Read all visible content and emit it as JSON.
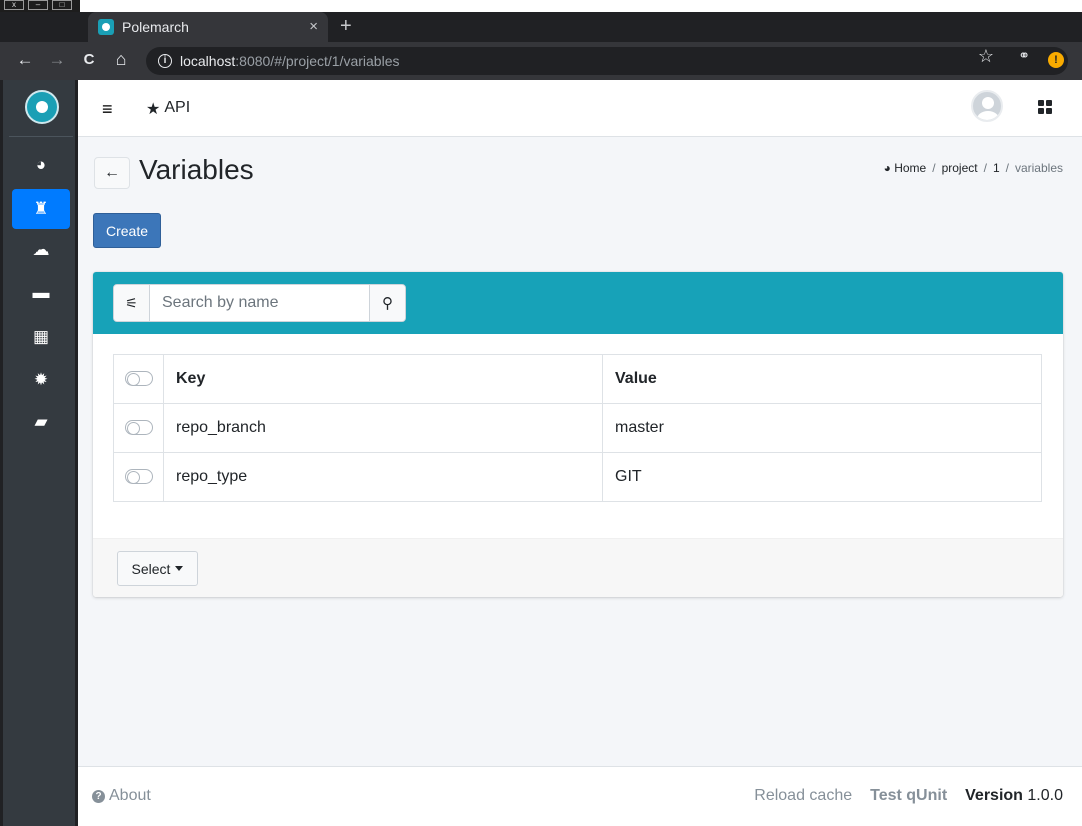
{
  "browser": {
    "tab_title": "Polemarch",
    "tab_close": "×",
    "new_tab": "+",
    "url_host": "localhost",
    "url_rest": ":8080/#/project/1/variables",
    "back": "←",
    "forward": "→",
    "reload": "C",
    "home": "⌂",
    "star": "☆",
    "info": "i",
    "alert": "!"
  },
  "window_controls": [
    "x",
    "–",
    "□"
  ],
  "topnav": {
    "menu_icon": "≡",
    "api_star": "★",
    "api_label": "API"
  },
  "sidebar": {
    "items": [
      {
        "name": "dashboard-icon",
        "glyph": "◕"
      },
      {
        "name": "projects-icon",
        "glyph": "♜",
        "active": true
      },
      {
        "name": "cloud-icon",
        "glyph": "☁"
      },
      {
        "name": "folder-icon",
        "glyph": "▬"
      },
      {
        "name": "calendar-icon",
        "glyph": "▦"
      },
      {
        "name": "settings-icon",
        "glyph": "✹"
      },
      {
        "name": "book-icon",
        "glyph": "▰"
      }
    ]
  },
  "page": {
    "back_glyph": "←",
    "title": "Variables",
    "breadcrumb": {
      "home_icon": "◕",
      "home": "Home",
      "sep": "/",
      "project": "project",
      "id": "1",
      "current": "variables"
    },
    "create_label": "Create"
  },
  "search": {
    "filter_glyph": "⚟",
    "placeholder": "Search by name",
    "search_glyph": "⚲"
  },
  "table": {
    "headers": {
      "key": "Key",
      "value": "Value"
    },
    "rows": [
      {
        "key": "repo_branch",
        "value": "master"
      },
      {
        "key": "repo_type",
        "value": "GIT"
      }
    ]
  },
  "card_footer": {
    "select_label": "Select"
  },
  "footer": {
    "about": "About",
    "about_icon": "?",
    "reload_cache": "Reload cache",
    "test_qunit": "Test qUnit",
    "version_label": "Version",
    "version_value": "1.0.0"
  },
  "colors": {
    "sidebar_bg": "#343a40",
    "active_item": "#007bff",
    "header_teal": "#17a2b8",
    "create_btn": "#3c76b9",
    "main_bg": "#f4f6f9"
  }
}
